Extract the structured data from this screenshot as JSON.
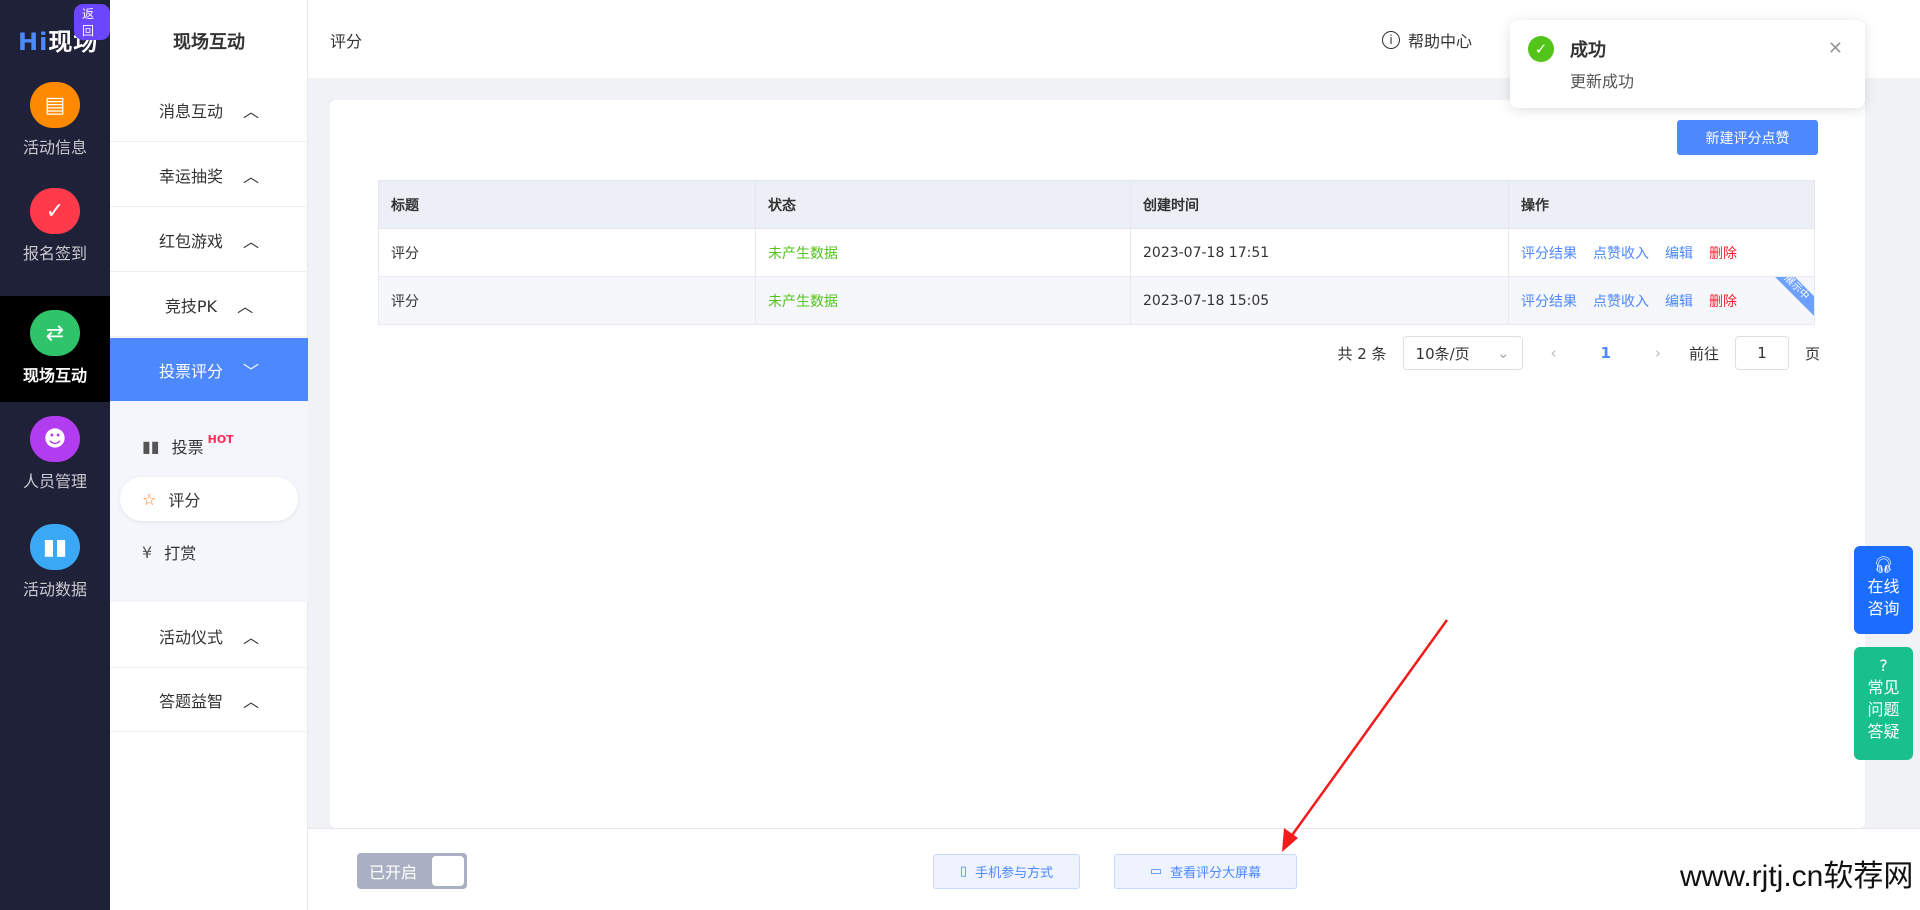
{
  "brand": {
    "logo": "Hi现场",
    "back": "返回"
  },
  "nav": [
    {
      "label": "活动信息",
      "icon": "document-icon",
      "color": "#ff8a00"
    },
    {
      "label": "报名签到",
      "icon": "calendar-check-icon",
      "color": "#ff3a4a"
    },
    {
      "label": "现场互动",
      "icon": "interaction-icon",
      "color": "#2fc46a",
      "active": true
    },
    {
      "label": "人员管理",
      "icon": "person-card-icon",
      "color": "#b23cf0"
    },
    {
      "label": "活动数据",
      "icon": "bar-chart-icon",
      "color": "#3aa8f5"
    }
  ],
  "side": {
    "title": "现场互动",
    "menus": [
      "消息互动",
      "幸运抽奖",
      "红包游戏",
      "竞技PK",
      "投票评分",
      "活动仪式",
      "答题益智"
    ],
    "sub": [
      {
        "label": "投票",
        "badge": "HOT"
      },
      {
        "label": "评分"
      },
      {
        "label": "打赏"
      }
    ]
  },
  "header": {
    "crumb": "评分",
    "help": "帮助中心"
  },
  "toast": {
    "title": "成功",
    "message": "更新成功"
  },
  "main": {
    "new_button": "新建评分点赞",
    "columns": [
      "标题",
      "状态",
      "创建时间",
      "操作"
    ],
    "rows": [
      {
        "title": "评分",
        "status": "未产生数据",
        "created": "2023-07-18 17:51",
        "ops": [
          "评分结果",
          "点赞收入",
          "编辑",
          "删除"
        ]
      },
      {
        "title": "评分",
        "status": "未产生数据",
        "created": "2023-07-18 15:05",
        "ops": [
          "评分结果",
          "点赞收入",
          "编辑",
          "删除"
        ],
        "ribbon": "展示中"
      }
    ],
    "pager": {
      "total": "共 2 条",
      "page_size": "10条/页",
      "current": "1",
      "goto_label": "前往",
      "goto_value": "1",
      "page_suffix": "页"
    }
  },
  "bottom": {
    "toggle": "已开启",
    "mobile": "手机参与方式",
    "screen": "查看评分大屏幕",
    "watermark": "www.rjtj.cn软荐网"
  },
  "float": {
    "consult": [
      "在线",
      "咨询"
    ],
    "faq": [
      "常见",
      "问题",
      "答疑"
    ]
  },
  "colors": {
    "primary": "#4d88ff",
    "success": "#52c41a",
    "danger": "#f5222d",
    "nav_bg": "#1f2138"
  }
}
